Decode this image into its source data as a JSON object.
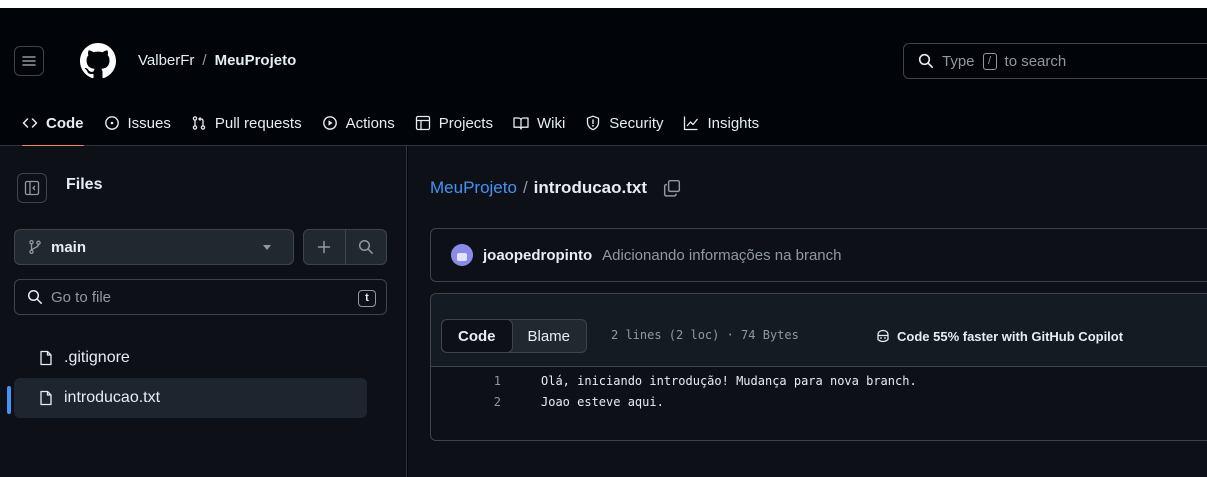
{
  "header": {
    "owner": "ValberFr",
    "separator": "/",
    "repo": "MeuProjeto",
    "search_prefix": "Type",
    "search_key": "/",
    "search_suffix": "to search"
  },
  "repo_tabs": [
    {
      "label": "Code",
      "icon": "code-icon",
      "active": true
    },
    {
      "label": "Issues",
      "icon": "issue-icon"
    },
    {
      "label": "Pull requests",
      "icon": "pull-request-icon"
    },
    {
      "label": "Actions",
      "icon": "play-icon"
    },
    {
      "label": "Projects",
      "icon": "table-icon"
    },
    {
      "label": "Wiki",
      "icon": "book-icon"
    },
    {
      "label": "Security",
      "icon": "shield-icon"
    },
    {
      "label": "Insights",
      "icon": "graph-icon"
    }
  ],
  "sidebar": {
    "title": "Files",
    "branch": "main",
    "goto_placeholder": "Go to file",
    "goto_shortcut": "t",
    "files": [
      {
        "name": ".gitignore",
        "selected": false
      },
      {
        "name": "introducao.txt",
        "selected": true
      }
    ]
  },
  "main": {
    "path_repo": "MeuProjeto",
    "path_sep": "/",
    "path_file": "introducao.txt",
    "commit": {
      "author": "joaopedropinto",
      "message": "Adicionando informações na branch"
    },
    "file": {
      "view_code": "Code",
      "view_blame": "Blame",
      "meta": "2 lines (2 loc) · 74 Bytes",
      "copilot": "Code 55% faster with GitHub Copilot",
      "lines": [
        {
          "num": "1",
          "text": "Olá, iniciando introdução! Mudança para nova branch."
        },
        {
          "num": "2",
          "text": "Joao esteve aqui."
        }
      ]
    }
  },
  "colors": {
    "accent_link": "#4493f8",
    "tab_underline": "#f78166",
    "background": "#0d1117"
  }
}
